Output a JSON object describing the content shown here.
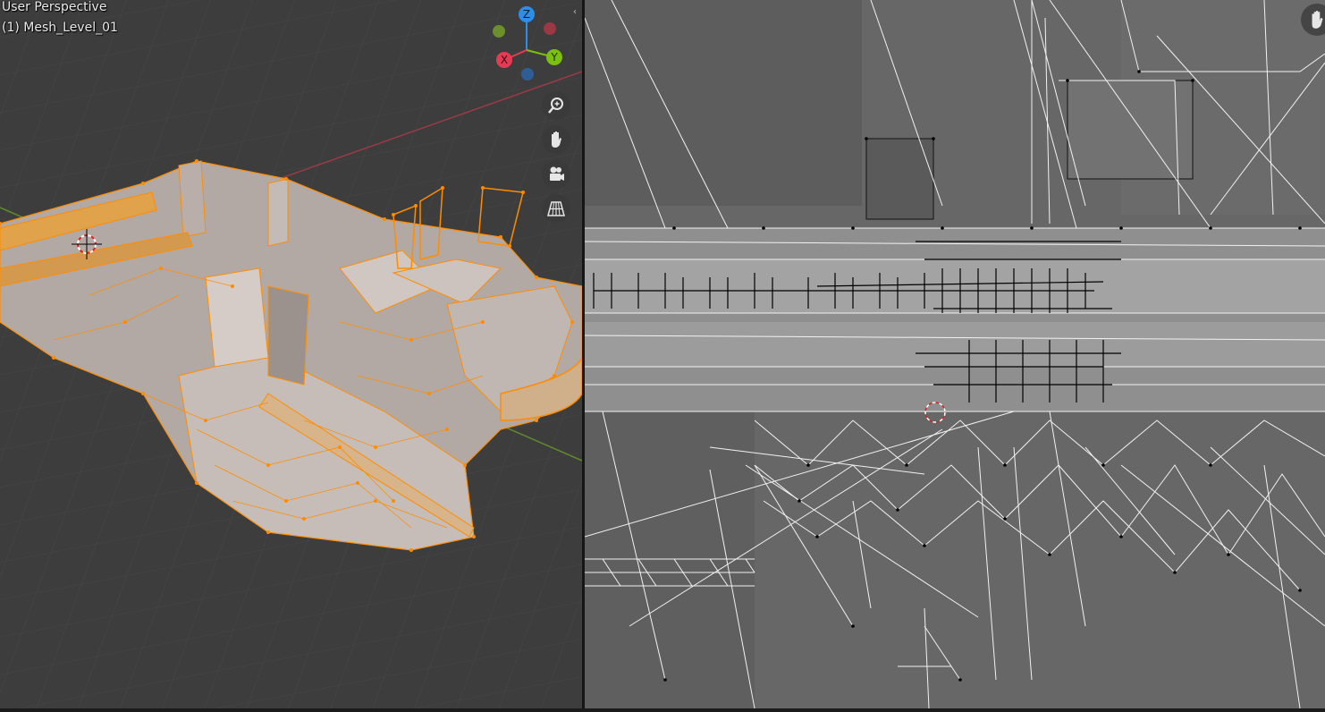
{
  "viewport3d": {
    "title": "User Perspective",
    "object_label": "(1) Mesh_Level_01",
    "gizmo": {
      "z": "Z",
      "y": "Y",
      "x": "X"
    },
    "nav_buttons": [
      "zoom-icon",
      "hand-icon",
      "camera-icon",
      "grid-icon"
    ]
  },
  "uv_editor": {
    "nav_button": "hand-icon"
  },
  "colors": {
    "viewport_bg": "#3d3d3d",
    "uv_bg": "#676767",
    "selection": "#ff8c00",
    "axis_x": "#e43b54",
    "axis_y": "#7bbf0f",
    "axis_z": "#2c8ee8"
  }
}
